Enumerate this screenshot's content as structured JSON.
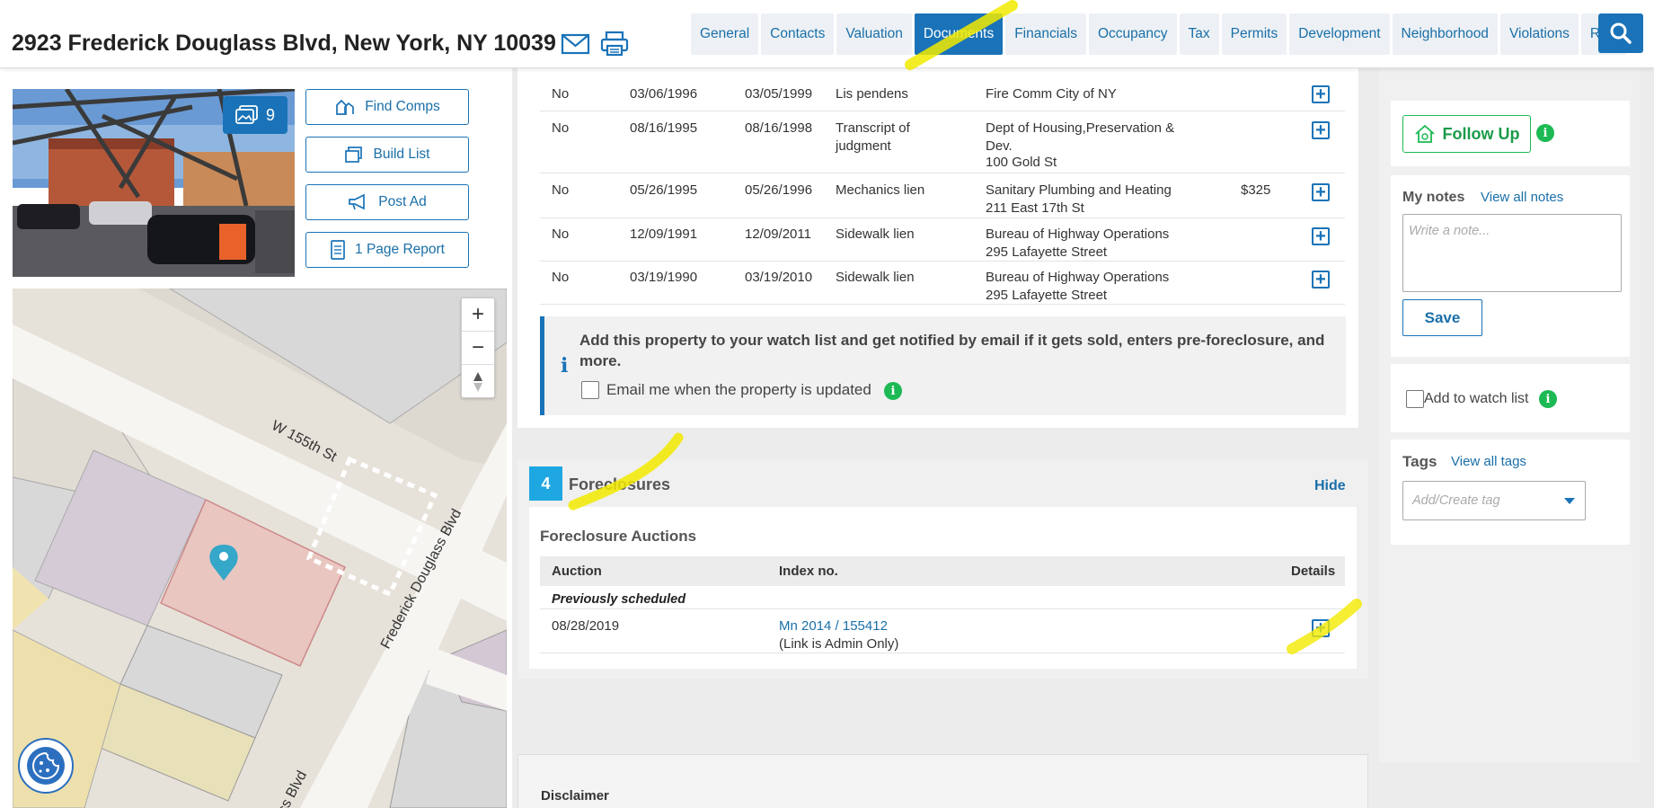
{
  "header": {
    "address": "2923 Frederick Douglass Blvd, New York, NY 10039",
    "tabs": [
      "General",
      "Contacts",
      "Valuation",
      "Documents",
      "Financials",
      "Occupancy",
      "Tax",
      "Permits",
      "Development",
      "Neighborhood",
      "Violations",
      "Risk"
    ],
    "active_tab": "Documents"
  },
  "left": {
    "photo_count": "9",
    "buttons": {
      "find_comps": "Find Comps",
      "build_list": "Build List",
      "post_ad": "Post Ad",
      "page_report": "1 Page Report"
    },
    "map": {
      "street_1": "W 155th St",
      "street_2": "Frederick Douglass Blvd",
      "street_3": "ass Blvd"
    }
  },
  "documents": {
    "rows": [
      {
        "satisfied": "No",
        "date": "03/06/1996",
        "expires": "03/05/1999",
        "type": "Lis pendens",
        "party": "Fire Comm City of NY",
        "party_addr": "",
        "amount": ""
      },
      {
        "satisfied": "No",
        "date": "08/16/1995",
        "expires": "08/16/1998",
        "type": "Transcript of judgment",
        "party": "Dept of Housing,Preservation & Dev.",
        "party_addr": "100 Gold St",
        "amount": ""
      },
      {
        "satisfied": "No",
        "date": "05/26/1995",
        "expires": "05/26/1996",
        "type": "Mechanics lien",
        "party": "Sanitary Plumbing and Heating",
        "party_addr": "211 East 17th St",
        "amount": "$325"
      },
      {
        "satisfied": "No",
        "date": "12/09/1991",
        "expires": "12/09/2011",
        "type": "Sidewalk lien",
        "party": "Bureau of Highway Operations",
        "party_addr": "295 Lafayette Street",
        "amount": ""
      },
      {
        "satisfied": "No",
        "date": "03/19/1990",
        "expires": "03/19/2010",
        "type": "Sidewalk lien",
        "party": "Bureau of Highway Operations",
        "party_addr": "295 Lafayette Street",
        "amount": ""
      }
    ],
    "watch_message": "Add this property to your watch list and get notified by email if it gets sold, enters pre-foreclosure, and more.",
    "email_label": "Email me when the property is updated"
  },
  "foreclosures": {
    "section_number": "4",
    "title": "Foreclosures",
    "hide_label": "Hide",
    "subtitle": "Foreclosure Auctions",
    "columns": [
      "Auction",
      "Index no.",
      "Details"
    ],
    "group_label": "Previously scheduled",
    "rows": [
      {
        "auction": "08/28/2019",
        "index": "Mn 2014 / 155412",
        "note": "(Link is Admin Only)"
      }
    ]
  },
  "disclaimer": {
    "title": "Disclaimer"
  },
  "right": {
    "follow_up": "Follow Up",
    "notes_label": "My notes",
    "view_notes": "View all notes",
    "notes_placeholder": "Write a note...",
    "save": "Save",
    "watch_label": "Add to watch list",
    "tags_label": "Tags",
    "view_tags": "View all tags",
    "tag_placeholder": "Add/Create tag"
  },
  "colors": {
    "accent": "#1a73b8",
    "green": "#1db954",
    "highlight": "#f2ea00"
  }
}
